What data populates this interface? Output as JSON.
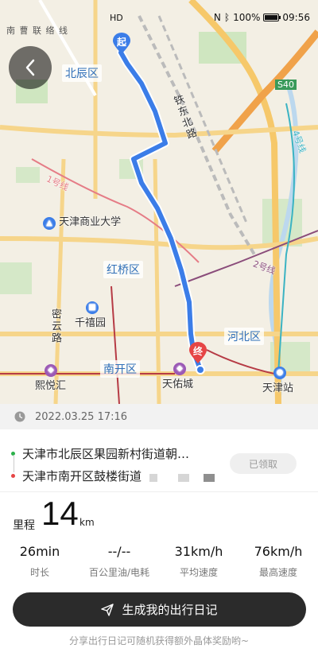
{
  "status_bar": {
    "carrier_text": "南 曹 联 络 线",
    "signal_text": "HD",
    "battery_percent": "100%",
    "time": "09:56"
  },
  "map": {
    "districts": [
      "北辰区",
      "红桥区",
      "河北区",
      "南开区"
    ],
    "pois": [
      "天津商业大学",
      "千禧园",
      "熙悦汇",
      "天佑城",
      "天津站"
    ],
    "roads": [
      "铁东北路",
      "密云路",
      "S40",
      "1号线",
      "4号线",
      "2号线"
    ],
    "start_marker": "起",
    "end_marker": "终",
    "route_color": "#3b7de8"
  },
  "trip": {
    "date": "2022.03.25 17:16",
    "start_address": "天津市北辰区果园新村街道朝…",
    "end_address": "天津市南开区鼓楼街道",
    "claimed_label": "已领取",
    "start_dot_color": "#2bb14a",
    "end_dot_color": "#e64545"
  },
  "mileage": {
    "label": "里程",
    "value": "14",
    "unit": "km"
  },
  "stats": [
    {
      "value": "26min",
      "label": "时长"
    },
    {
      "value": "--/--",
      "label": "百公里油/电耗"
    },
    {
      "value": "31km/h",
      "label": "平均速度"
    },
    {
      "value": "76km/h",
      "label": "最高速度"
    }
  ],
  "cta": {
    "label": "生成我的出行日记",
    "icon": "send-icon"
  },
  "footnote": "分享出行日记可随机获得额外晶体奖励哟~"
}
